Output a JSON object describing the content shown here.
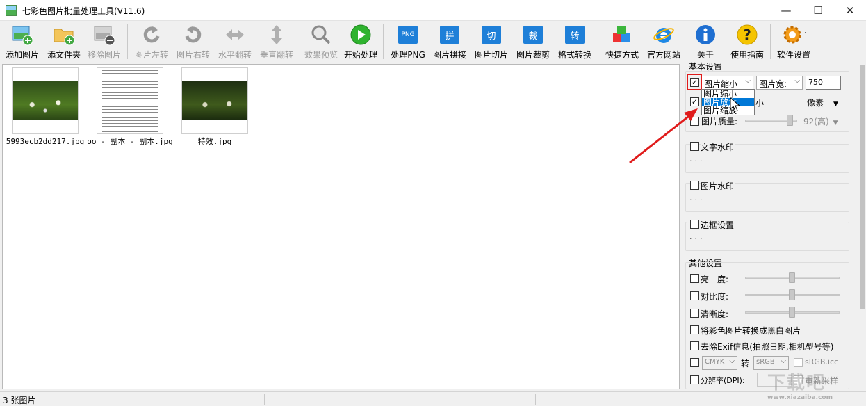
{
  "window": {
    "title": "七彩色图片批量处理工具(V11.6)",
    "minimize": "—",
    "maximize": "☐",
    "close": "✕"
  },
  "toolbar": {
    "add_image": "添加图片",
    "add_folder": "添文件夹",
    "remove_image": "移除图片",
    "rotate_left": "图片左转",
    "rotate_right": "图片右转",
    "flip_h": "水平翻转",
    "flip_v": "垂直翻转",
    "preview": "效果预览",
    "start": "开始处理",
    "process_png": "处理PNG",
    "png_badge": "PNG",
    "stitch": "图片拼接",
    "stitch_badge": "拼",
    "slice": "图片切片",
    "slice_badge": "切",
    "crop": "图片裁剪",
    "crop_badge": "裁",
    "convert": "格式转换",
    "convert_badge": "转",
    "shortcut": "快捷方式",
    "website": "官方网站",
    "about": "关于",
    "guide": "使用指南",
    "settings": "软件设置"
  },
  "files": [
    {
      "name": "5993ecb2dd217.jpg"
    },
    {
      "name": "oo - 副本 - 副本.jpg"
    },
    {
      "name": "特效.jpg"
    }
  ],
  "panel": {
    "basic_title": "基本设置",
    "resize_mode": "图片缩小",
    "dim_select": "图片宽:",
    "width_value": "750",
    "row2_suffix": "小",
    "unit": "像素",
    "quality_label": "图片质量:",
    "quality_value": "92(高)",
    "text_wm": "文字水印",
    "image_wm": "图片水印",
    "border": "边框设置",
    "dots": "...",
    "dropdown": [
      "图片缩小",
      "图片放大",
      "图片缩放"
    ],
    "other_title": "其他设置",
    "brightness": "亮　度:",
    "contrast": "对比度:",
    "sharpness": "清晰度:",
    "grayscale": "将彩色图片转换成黑白图片",
    "exif": "去除Exif信息(拍照日期,相机型号等)",
    "cmyk": "CMYK",
    "to": "转",
    "srgb": "sRGB",
    "srgb_icc": "sRGB.icc",
    "dpi": "分辨率(DPI):",
    "resample": "重新采样"
  },
  "status": {
    "count": "3 张图片"
  },
  "watermark": {
    "main": "下载吧",
    "sub": "www.xiazaiba.com"
  }
}
